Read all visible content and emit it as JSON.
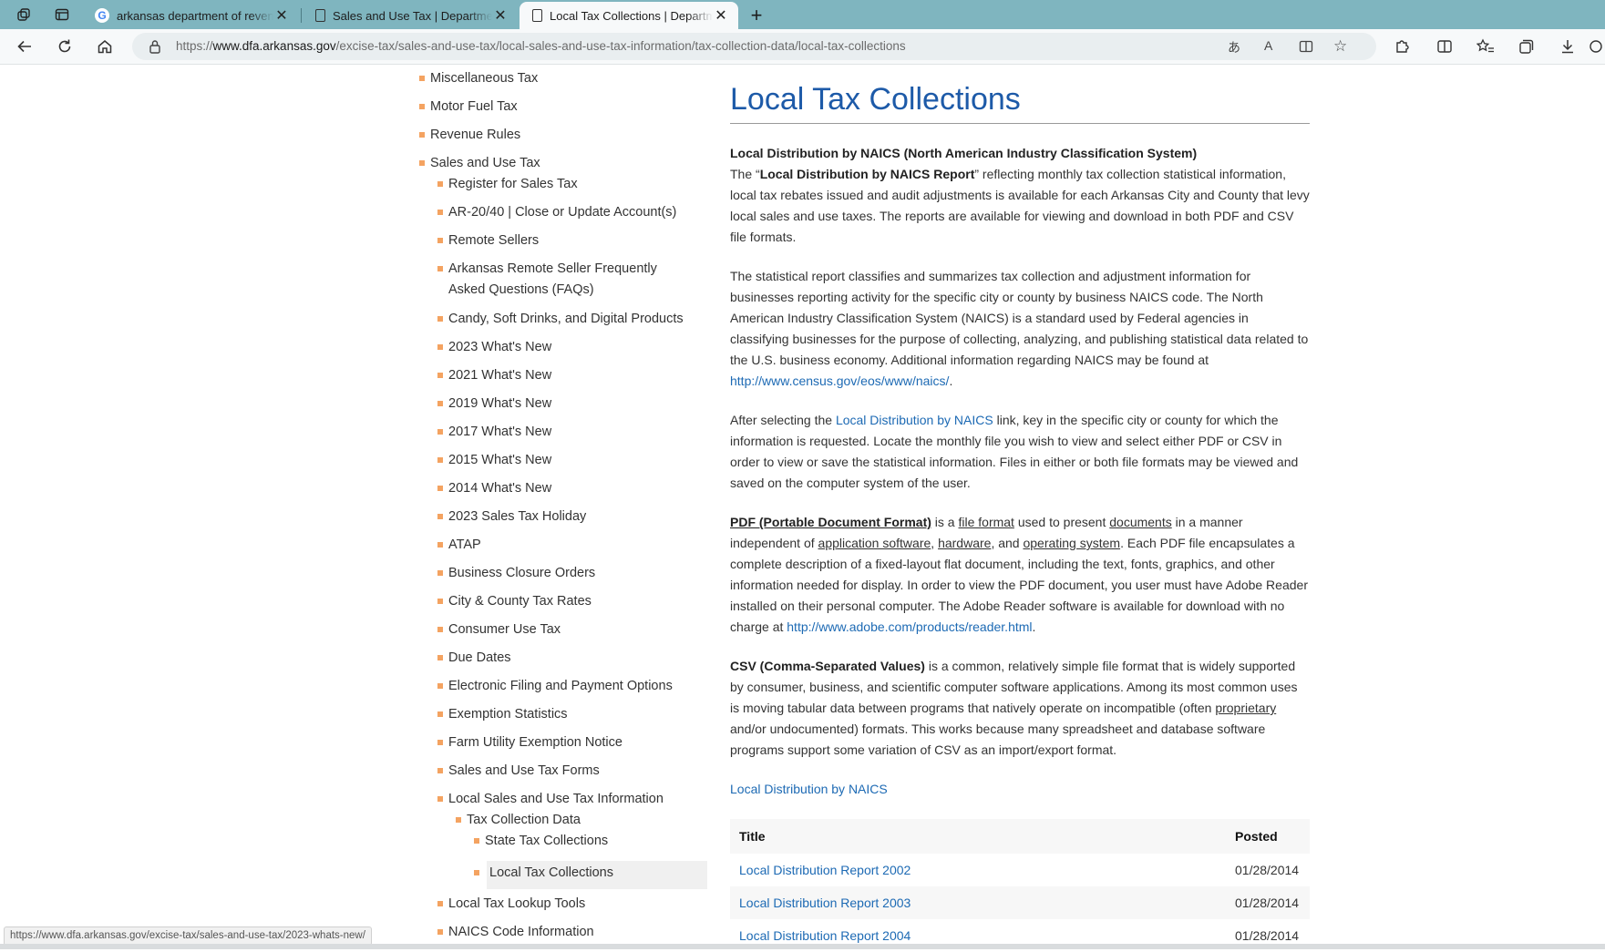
{
  "browser": {
    "tabs": [
      {
        "title": "arkansas department of revenue",
        "favicon": "google-icon"
      },
      {
        "title": "Sales and Use Tax | Department of",
        "favicon": "page-icon"
      },
      {
        "title": "Local Tax Collections | Department of",
        "favicon": "page-icon",
        "active": true
      }
    ],
    "url_prefix": "https://",
    "url_domain": "www.dfa.arkansas.gov",
    "url_path": "/excise-tax/sales-and-use-tax/local-sales-and-use-tax-information/tax-collection-data/local-tax-collections",
    "status_url": "https://www.dfa.arkansas.gov/excise-tax/sales-and-use-tax/2023-whats-new/",
    "accent_color": "#7fb5bf"
  },
  "nav": {
    "items": [
      {
        "label": "Miscellaneous Tax"
      },
      {
        "label": "Motor Fuel Tax"
      },
      {
        "label": "Revenue Rules"
      },
      {
        "label": "Sales and Use Tax"
      },
      {
        "label": "Register for Sales Tax"
      },
      {
        "label": "AR-20/40 | Close or Update Account(s)"
      },
      {
        "label": "Remote Sellers"
      },
      {
        "label": "Arkansas Remote Seller Frequently Asked Questions (FAQs)"
      },
      {
        "label": "Candy, Soft Drinks, and Digital Products"
      },
      {
        "label": "2023 What's New"
      },
      {
        "label": "2021 What's New"
      },
      {
        "label": "2019 What's New"
      },
      {
        "label": "2017 What's New"
      },
      {
        "label": "2015 What's New"
      },
      {
        "label": "2014 What's New"
      },
      {
        "label": "2023 Sales Tax Holiday"
      },
      {
        "label": "ATAP"
      },
      {
        "label": "Business Closure Orders"
      },
      {
        "label": "City & County Tax Rates"
      },
      {
        "label": "Consumer Use Tax"
      },
      {
        "label": "Due Dates"
      },
      {
        "label": "Electronic Filing and Payment Options"
      },
      {
        "label": "Exemption Statistics"
      },
      {
        "label": "Farm Utility Exemption Notice"
      },
      {
        "label": "Sales and Use Tax Forms"
      },
      {
        "label": "Local Sales and Use Tax Information"
      },
      {
        "label": "Tax Collection Data"
      },
      {
        "label": "State Tax Collections"
      },
      {
        "label": "Local Tax Collections",
        "current": true
      },
      {
        "label": "Local Tax Lookup Tools"
      },
      {
        "label": "NAICS Code Information"
      }
    ],
    "bullet_color": "#f4a361"
  },
  "content": {
    "title": "Local Tax Collections",
    "heading": "Local Distribution by NAICS (North American Industry Classification System)",
    "p1_pre": "The “",
    "p1_bold": "Local Distribution by NAICS Report",
    "p1_post": "” reflecting monthly tax collection statistical information, local tax rebates issued and audit adjustments is available for each Arkansas City and County that levy local sales and use taxes.   The reports are available for viewing and download in both PDF and CSV file formats.",
    "p2": "The statistical report classifies and summarizes tax collection and adjustment information for businesses reporting activity for the specific city or county by business NAICS code.  The North American Industry Classification System (NAICS) is a standard used by Federal agencies in classifying businesses for the purpose of collecting, analyzing, and publishing statistical data related to the U.S. business economy.  Additional information regarding NAICS may be found at ",
    "p2_link": "http://www.census.gov/eos/www/naics/",
    "p2_end": ".",
    "p3_pre": "After selecting the ",
    "p3_link": "Local Distribution by NAICS",
    "p3_post": " link, key in the specific city or county for which the information is requested.  Locate the monthly file you wish to view and select either PDF or CSV in order to view or save the statistical information.  Files in either or both file formats may be viewed and saved on the computer system of the user.",
    "p4_bold": "PDF (Portable Document Format)",
    "p4_a": " is a ",
    "p4_u1": "file format",
    "p4_b": " used to present ",
    "p4_u2": "documents",
    "p4_c": " in a manner independent of ",
    "p4_u3": "application software",
    "p4_d": ", ",
    "p4_u4": "hardware",
    "p4_e": ", and ",
    "p4_u5": "operating system",
    "p4_f": ".   Each PDF file encapsulates a complete description of a fixed-layout flat document, including the text, fonts, graphics, and other information needed for display.  In order to view the PDF document, you user must have Adobe Reader installed on their personal computer.  The Adobe Reader software is available for download with no charge at ",
    "p4_link": "http://www.adobe.com/products/reader.html",
    "p4_end": ".",
    "p5_bold": "CSV (Comma-Separated Values)",
    "p5_a": " is a common, relatively simple file format that is widely supported by consumer, business, and scientific computer software applications.  Among its most common uses is moving tabular data between programs that natively operate on incompatible (often ",
    "p5_u": "proprietary",
    "p5_b": " and/or undocumented) formats. This works because many spreadsheet and database software programs support some variation of CSV as an import/export format.",
    "naics_link": "Local Distribution by NAICS",
    "table": {
      "headers": [
        "Title",
        "Posted"
      ],
      "rows": [
        [
          "Local Distribution Report 2002",
          "01/28/2014"
        ],
        [
          "Local Distribution Report 2003",
          "01/28/2014"
        ],
        [
          "Local Distribution Report 2004",
          "01/28/2014"
        ]
      ]
    },
    "title_color": "#1d5aa8",
    "link_color": "#1d6ab4"
  }
}
